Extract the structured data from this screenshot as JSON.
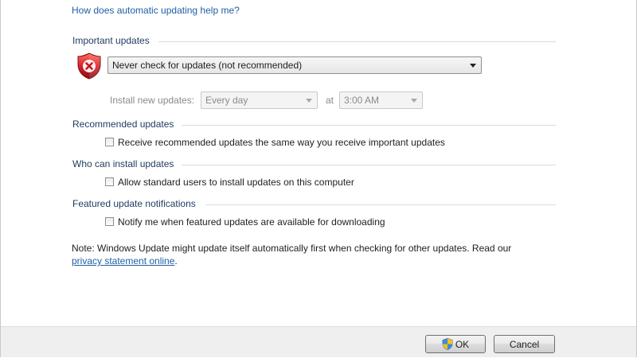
{
  "help_link": "How does automatic updating help me?",
  "important": {
    "title": "Important updates",
    "icon": "shield-error-icon",
    "mode_selected": "Never check for updates (not recommended)",
    "install_label": "Install new updates:",
    "day_selected": "Every day",
    "at_label": "at",
    "time_selected": "3:00 AM"
  },
  "recommended": {
    "title": "Recommended updates",
    "checkbox_label": "Receive recommended updates the same way you receive important updates",
    "checked": false
  },
  "who": {
    "title": "Who can install updates",
    "checkbox_label": "Allow standard users to install updates on this computer",
    "checked": false
  },
  "featured": {
    "title": "Featured update notifications",
    "checkbox_label": "Notify me when featured updates are available for downloading",
    "checked": false
  },
  "note": {
    "text": "Note: Windows Update might update itself automatically first when checking for other updates.  Read our",
    "link": "privacy statement online",
    "suffix": "."
  },
  "buttons": {
    "ok": "OK",
    "ok_icon": "uac-shield-icon",
    "cancel": "Cancel"
  },
  "colors": {
    "link": "#1f5fa6",
    "group_title": "#1e3a5f",
    "shield_red": "#c8171c"
  }
}
